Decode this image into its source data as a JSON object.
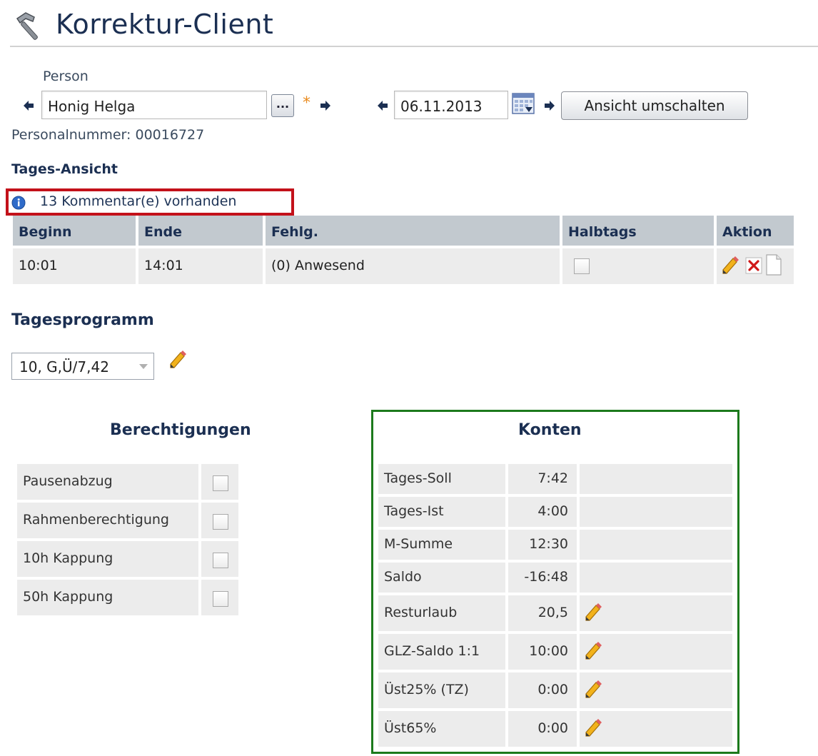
{
  "header": {
    "title": "Korrektur-Client",
    "icon": "hammer-icon"
  },
  "person": {
    "label": "Person",
    "name_value": "Honig Helga",
    "lookup_label": "...",
    "required_marker": "*",
    "personalnummer": "Personalnummer: 00016727"
  },
  "date": {
    "value": "06.11.2013",
    "icon": "calendar-icon"
  },
  "toggle_view_label": "Ansicht umschalten",
  "day_view": {
    "title": "Tages-Ansicht",
    "comment_notice": "13  Kommentar(e) vorhanden",
    "columns": [
      "Beginn",
      "Ende",
      "Fehlg.",
      "Halbtags",
      "Aktion"
    ],
    "rows": [
      {
        "beginn": "10:01",
        "ende": "14:01",
        "fehlg": "(0) Anwesend",
        "halbtags": false
      }
    ]
  },
  "tagesprogramm": {
    "title": "Tagesprogramm",
    "selected": "10, G,Ü/7,42"
  },
  "berechtigungen": {
    "title": "Berechtigungen",
    "items": [
      {
        "label": "Pausenabzug",
        "checked": false
      },
      {
        "label": "Rahmenberechtigung",
        "checked": false
      },
      {
        "label": "10h Kappung",
        "checked": false
      },
      {
        "label": "50h Kappung",
        "checked": false
      }
    ]
  },
  "konten": {
    "title": "Konten",
    "rows": [
      {
        "label": "Tages-Soll",
        "value": "7:42",
        "editable": false
      },
      {
        "label": "Tages-Ist",
        "value": "4:00",
        "editable": false
      },
      {
        "label": "M-Summe",
        "value": "12:30",
        "editable": false
      },
      {
        "label": "Saldo",
        "value": "-16:48",
        "editable": false
      },
      {
        "label": "Resturlaub",
        "value": "20,5",
        "editable": true
      },
      {
        "label": "GLZ-Saldo 1:1",
        "value": "10:00",
        "editable": true
      },
      {
        "label": "Üst25% (TZ)",
        "value": "0:00",
        "editable": true
      },
      {
        "label": "Üst65%",
        "value": "0:00",
        "editable": true
      }
    ]
  },
  "colors": {
    "heading": "#1b2f52",
    "highlight_red": "#c3111a",
    "highlight_green": "#1c7a1c",
    "table_header_bg": "#c2c9cf",
    "cell_bg": "#ececec",
    "required_orange": "#e98a1d"
  }
}
